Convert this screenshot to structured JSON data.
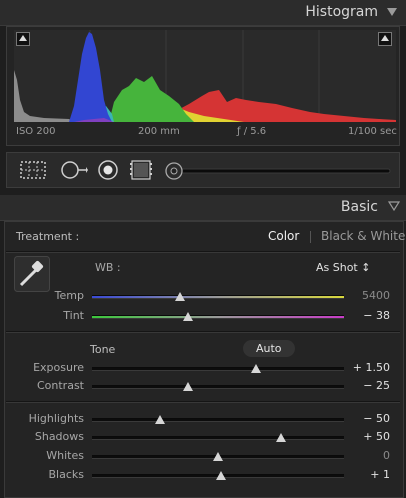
{
  "histogram": {
    "title": "Histogram",
    "iso": "ISO 200",
    "focal": "200 mm",
    "aperture": "ƒ / 5.6",
    "shutter": "1/100 sec"
  },
  "basic": {
    "title": "Basic",
    "treatment_label": "Treatment :",
    "treatment_color": "Color",
    "treatment_bw": "Black & White",
    "wb_label": "WB :",
    "wb_value": "As Shot ↕"
  },
  "sliders": {
    "temp": {
      "label": "Temp",
      "value": "5400",
      "pos": 0.35
    },
    "tint": {
      "label": "Tint",
      "value": "− 38",
      "pos": 0.38
    },
    "exposure": {
      "label": "Exposure",
      "value": "+ 1.50",
      "pos": 0.65
    },
    "contrast": {
      "label": "Contrast",
      "value": "− 25",
      "pos": 0.38
    },
    "highlights": {
      "label": "Highlights",
      "value": "− 50",
      "pos": 0.27
    },
    "shadows": {
      "label": "Shadows",
      "value": "+ 50",
      "pos": 0.75
    },
    "whites": {
      "label": "Whites",
      "value": "0",
      "pos": 0.5
    },
    "blacks": {
      "label": "Blacks",
      "value": "+ 1",
      "pos": 0.51
    }
  },
  "tone": {
    "label": "Tone",
    "auto": "Auto"
  },
  "colors": {
    "red": "#d53434",
    "green": "#46b43c",
    "blue": "#3246d2",
    "yellow": "#e1d232"
  }
}
